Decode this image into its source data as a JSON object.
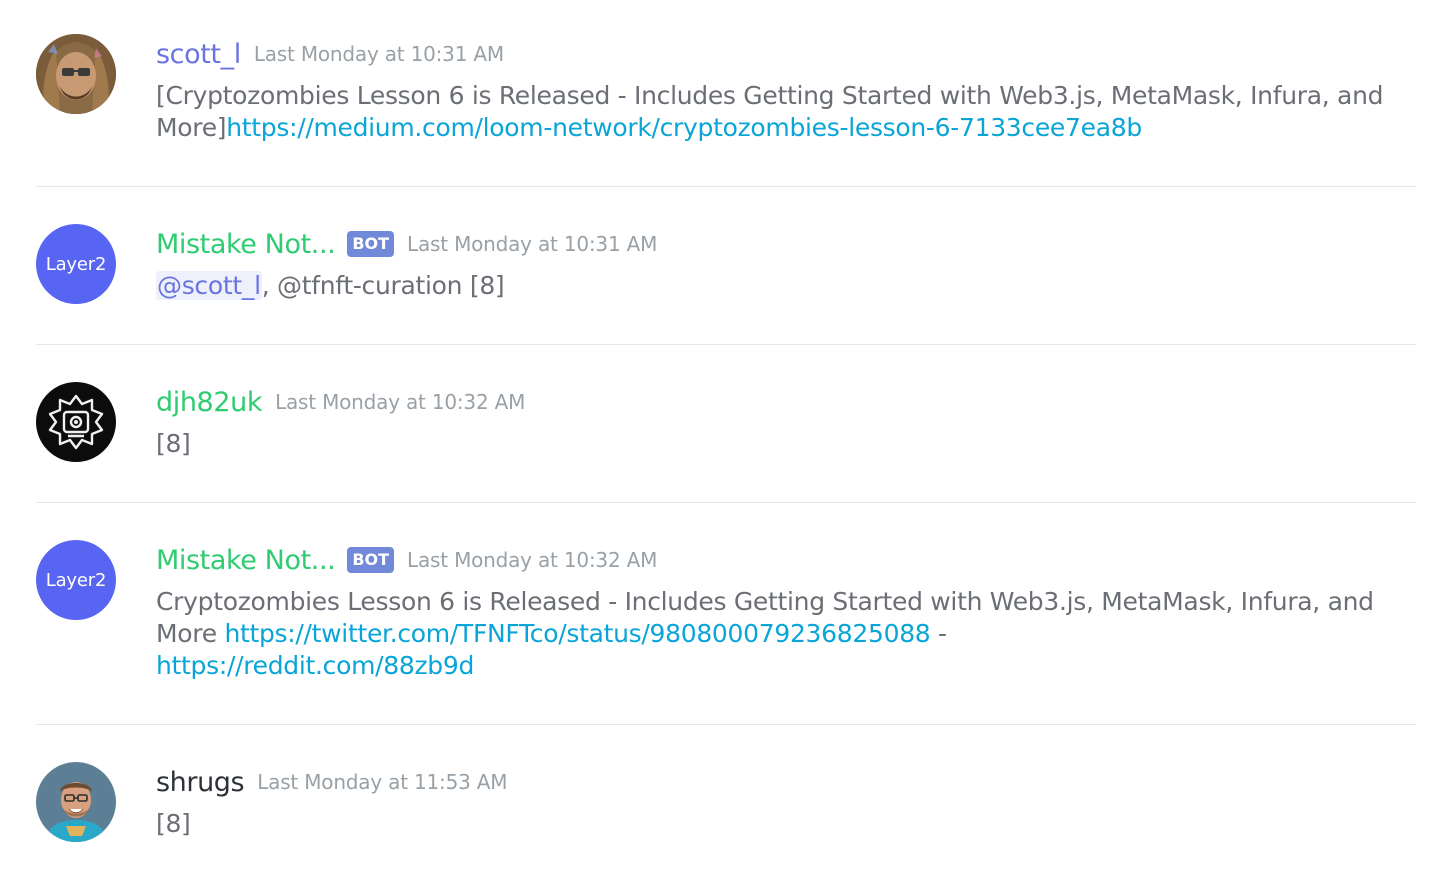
{
  "messages": [
    {
      "author": "scott_l",
      "timestamp": "Last Monday at 10:31 AM",
      "text_1": "[Cryptozombies Lesson 6 is Released - Includes Getting Started with Web3.js, MetaMask, Infura, and More]",
      "link_1": "https://medium.com/loom-network/cryptozombies-lesson-6-7133cee7ea8b"
    },
    {
      "author": "Mistake Not...",
      "badge": "BOT",
      "avatar_text": "Layer2",
      "timestamp": "Last Monday at 10:31 AM",
      "mention": "@scott_l",
      "text_1": ", @tfnft-curation [8]"
    },
    {
      "author": "djh82uk",
      "timestamp": "Last Monday at 10:32 AM",
      "text_1": "[8]"
    },
    {
      "author": "Mistake Not...",
      "badge": "BOT",
      "avatar_text": "Layer2",
      "timestamp": "Last Monday at 10:32 AM",
      "text_1": "Cryptozombies Lesson 6 is Released - Includes Getting Started with Web3.js, MetaMask, Infura, and More ",
      "link_1": "https://twitter.com/TFNFTco/status/980800079236825088",
      "text_2": " - ",
      "link_2": "https://reddit.com/88zb9d"
    },
    {
      "author": "shrugs",
      "timestamp": "Last Monday at 11:53 AM",
      "text_1": "[8]"
    }
  ],
  "colors": {
    "author_blue": "#6a74e0",
    "author_green": "#2fcc71",
    "author_dark": "#2e3238",
    "link": "#0aa5d8",
    "timestamp": "#99a1a7",
    "body_text": "#6b6f75",
    "bot_badge": "#7289da",
    "layer2_avatar": "#5865f2"
  },
  "icons": {
    "avatar_1": "user-photo-avatar",
    "avatar_3": "aztec-emblem-avatar",
    "avatar_5": "user-photo-avatar"
  }
}
